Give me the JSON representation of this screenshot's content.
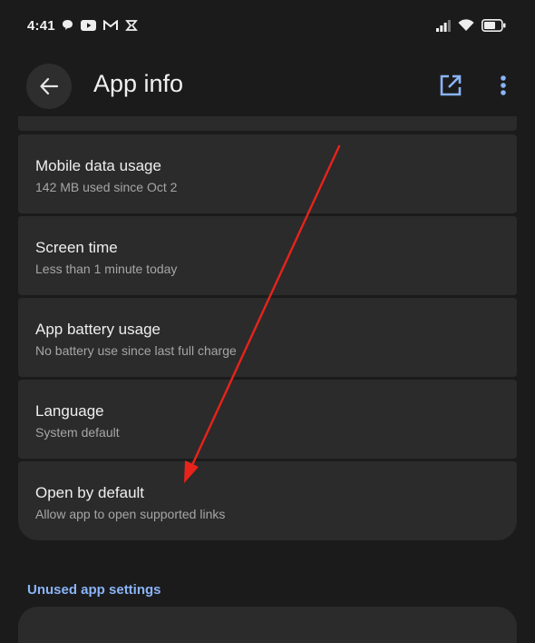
{
  "status_bar": {
    "time": "4:41",
    "left_icons": [
      "chat-icon",
      "youtube-icon",
      "gmail-icon",
      "app-icon"
    ],
    "right_icons": [
      "signal-icon",
      "wifi-icon",
      "battery-icon"
    ]
  },
  "app_bar": {
    "title": "App info",
    "back_icon": "arrow-back-icon",
    "open_icon": "open-in-new-icon",
    "more_icon": "more-vert-icon",
    "accent_color": "#8ab4f8"
  },
  "settings": [
    {
      "title": "Mobile data usage",
      "subtitle": "142 MB used since Oct 2"
    },
    {
      "title": "Screen time",
      "subtitle": "Less than 1 minute today"
    },
    {
      "title": "App battery usage",
      "subtitle": "No battery use since last full charge"
    },
    {
      "title": "Language",
      "subtitle": "System default"
    },
    {
      "title": "Open by default",
      "subtitle": "Allow app to open supported links"
    }
  ],
  "section_header": "Unused app settings",
  "colors": {
    "background": "#1b1b1b",
    "card": "#2b2b2b",
    "annotation_arrow": "#e8231b"
  }
}
